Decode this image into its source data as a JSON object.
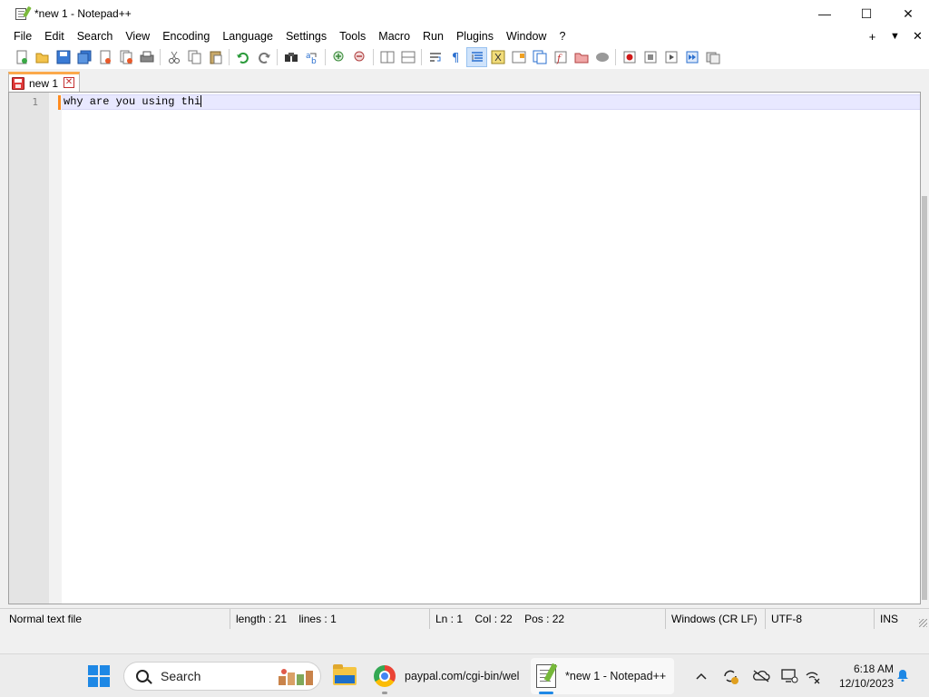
{
  "window": {
    "title": "*new 1 - Notepad++",
    "controls": {
      "minimize": "—",
      "maximize": "☐",
      "close": "✕"
    }
  },
  "menu": {
    "items": [
      "File",
      "Edit",
      "Search",
      "View",
      "Encoding",
      "Language",
      "Settings",
      "Tools",
      "Macro",
      "Run",
      "Plugins",
      "Window",
      "?"
    ],
    "right": {
      "add": "+",
      "dropdown": "▼",
      "close": "✕"
    }
  },
  "toolbar": {
    "icons": [
      "new-file",
      "open-file",
      "save",
      "save-all",
      "close",
      "close-all",
      "print",
      "cut",
      "copy",
      "paste",
      "undo",
      "redo",
      "find",
      "replace",
      "zoom-in",
      "zoom-out",
      "sync-vertical",
      "sync-horizontal",
      "word-wrap",
      "show-all-characters",
      "indent-guide",
      "user-defined-language",
      "document-map",
      "function-list",
      "folder-as-workspace",
      "monitoring",
      "record-macro",
      "stop-recording",
      "playback-macro",
      "run-macro-multiple",
      "save-macro"
    ],
    "active": "indent-guide"
  },
  "tab": {
    "label": "new 1",
    "close": "✕"
  },
  "editor": {
    "line_number": "1",
    "line_text": "why are you using thi"
  },
  "status": {
    "file_type": "Normal text file",
    "length": "length : 21",
    "lines": "lines : 1",
    "ln": "Ln : 1",
    "col": "Col : 22",
    "pos": "Pos : 22",
    "eol": "Windows (CR LF)",
    "encoding": "UTF-8",
    "mode": "INS"
  },
  "taskbar": {
    "search_label": "Search",
    "chrome_label": "paypal.com/cgi-bin/wel",
    "npp_label": "*new 1 - Notepad++",
    "time": "6:18 AM",
    "date": "12/10/2023"
  },
  "colors": {
    "accent": "#1e88e5",
    "tab_highlight": "#fba94b",
    "current_line": "#e8e8ff"
  }
}
